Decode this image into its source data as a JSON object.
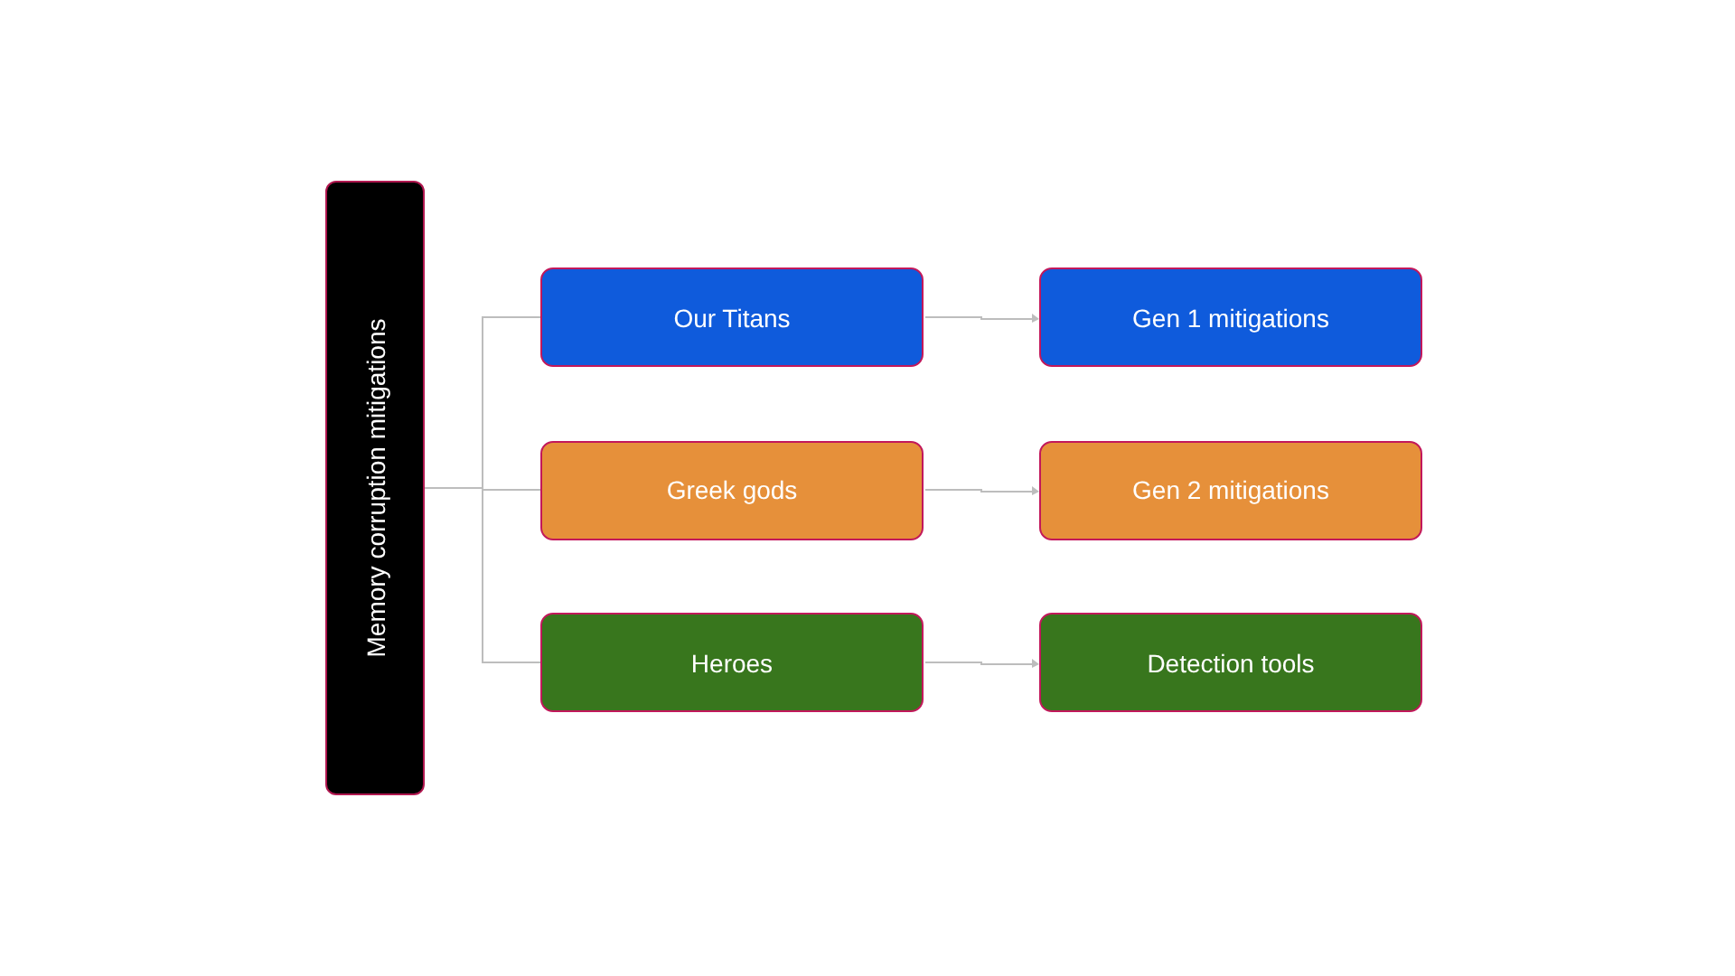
{
  "root": {
    "label": "Memory corruption mitigations"
  },
  "rows": [
    {
      "color": "#0f5bdc",
      "left": "Our Titans",
      "right": "Gen 1 mitigations"
    },
    {
      "color": "#e6903a",
      "left": "Greek gods",
      "right": "Gen 2 mitigations"
    },
    {
      "color": "#38761d",
      "left": "Heroes",
      "right": "Detection tools"
    }
  ]
}
